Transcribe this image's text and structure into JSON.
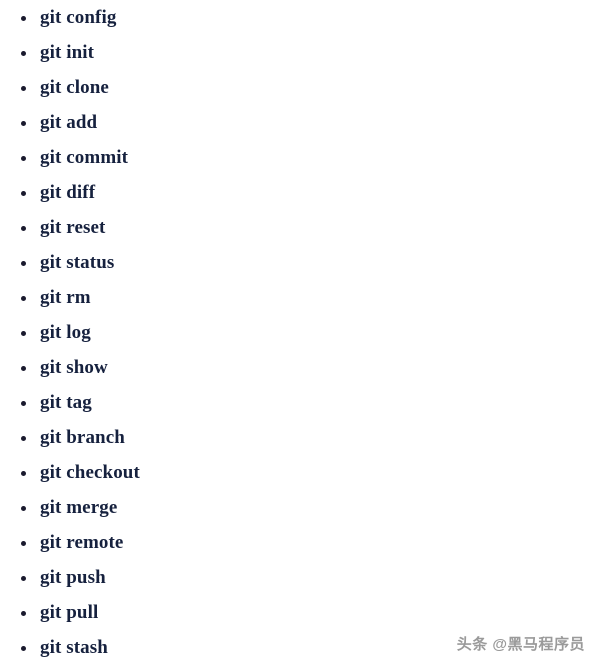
{
  "page": {
    "background_color": "#ffffff",
    "text_color": "#16213e",
    "bullet_color": "#1a1a2e"
  },
  "list": {
    "bullet_glyph": "•",
    "items": [
      {
        "label": "git config"
      },
      {
        "label": "git init"
      },
      {
        "label": "git clone"
      },
      {
        "label": "git add"
      },
      {
        "label": "git commit"
      },
      {
        "label": "git diff"
      },
      {
        "label": "git reset"
      },
      {
        "label": "git status"
      },
      {
        "label": "git rm"
      },
      {
        "label": "git log"
      },
      {
        "label": "git show"
      },
      {
        "label": "git tag"
      },
      {
        "label": "git branch"
      },
      {
        "label": "git checkout"
      },
      {
        "label": "git merge"
      },
      {
        "label": "git remote"
      },
      {
        "label": "git push"
      },
      {
        "label": "git pull"
      },
      {
        "label": "git stash"
      }
    ]
  },
  "watermark": {
    "text": "头条 @黑马程序员",
    "color": "#9a9a9a"
  }
}
